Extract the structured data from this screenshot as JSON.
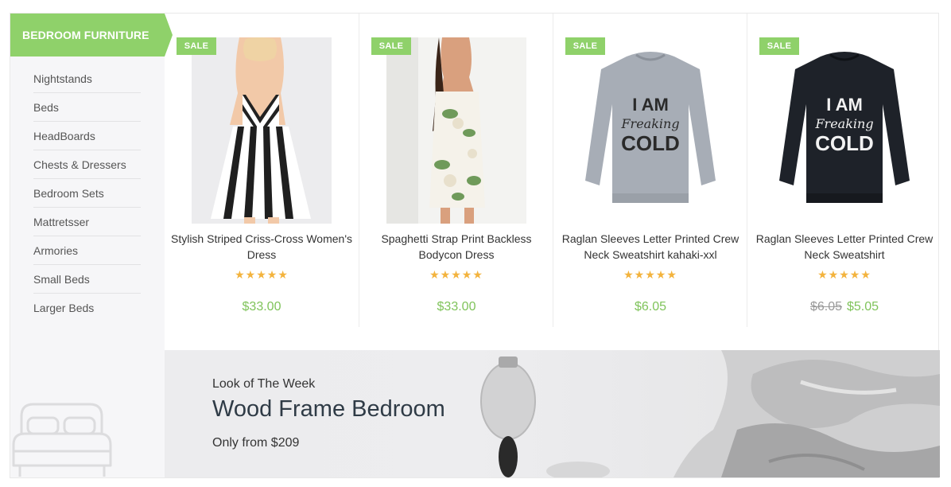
{
  "sidebar": {
    "title": "BEDROOM FURNITURE",
    "accent_color": "#8fd16a",
    "items": [
      "Nightstands",
      "Beds",
      "HeadBoards",
      "Chests & Dressers",
      "Bedroom Sets",
      "Mattretsser",
      "Armories",
      "Small Beds",
      "Larger Beds"
    ],
    "decor_icon": "bed-icon"
  },
  "products": [
    {
      "badge": "SALE",
      "name": "Stylish Striped Criss-Cross Women's Dress",
      "rating": 5,
      "stars": "★★★★★",
      "price": "$33.00",
      "old_price": ""
    },
    {
      "badge": "SALE",
      "name": "Spaghetti Strap Print Backless Bodycon Dress",
      "rating": 5,
      "stars": "★★★★★",
      "price": "$33.00",
      "old_price": ""
    },
    {
      "badge": "SALE",
      "name": "Raglan Sleeves Letter Printed Crew Neck Sweatshirt kahaki-xxl",
      "rating": 5,
      "stars": "★★★★★",
      "price": "$6.05",
      "old_price": ""
    },
    {
      "badge": "SALE",
      "name": "Raglan Sleeves Letter Printed Crew Neck Sweatshirt",
      "rating": 5,
      "stars": "★★★★★",
      "price": "$5.05",
      "old_price": "$6.05"
    }
  ],
  "sweatshirt_print": [
    "I AM",
    "Freaking",
    "COLD"
  ],
  "banner": {
    "subtitle": "Look of The Week",
    "title": "Wood Frame Bedroom",
    "price_text": "Only from $209"
  },
  "colors": {
    "price": "#7fc35a",
    "star": "#f3b33d",
    "badge": "#8fd16a"
  }
}
